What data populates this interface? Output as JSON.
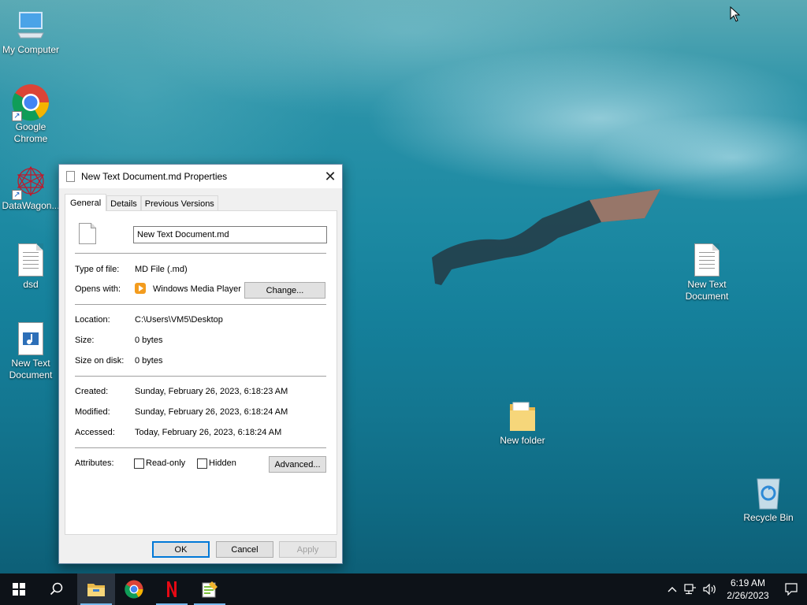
{
  "desktop": {
    "icons": [
      {
        "id": "my-computer",
        "label": "My Computer"
      },
      {
        "id": "google-chrome",
        "label": "Google Chrome"
      },
      {
        "id": "datawagon",
        "label": "DataWagon..."
      },
      {
        "id": "dsd",
        "label": "dsd"
      },
      {
        "id": "new-text-doc-left",
        "label": "New Text Document"
      },
      {
        "id": "new-text-doc-right",
        "label": "New Text Document"
      },
      {
        "id": "new-folder",
        "label": "New folder"
      },
      {
        "id": "recycle-bin",
        "label": "Recycle Bin"
      }
    ]
  },
  "dialog": {
    "title": "New Text Document.md Properties",
    "tabs": [
      {
        "label": "General",
        "active": true
      },
      {
        "label": "Details",
        "active": false
      },
      {
        "label": "Previous Versions",
        "active": false
      }
    ],
    "file_name": "New Text Document.md",
    "type_label": "Type of file:",
    "type_value": "MD File (.md)",
    "opens_label": "Opens with:",
    "opens_value": "Windows Media Player",
    "change_button": "Change...",
    "location_label": "Location:",
    "location_value": "C:\\Users\\VM5\\Desktop",
    "size_label": "Size:",
    "size_value": "0 bytes",
    "size_on_disk_label": "Size on disk:",
    "size_on_disk_value": "0 bytes",
    "created_label": "Created:",
    "created_value": "Sunday, February 26, 2023, 6:18:23 AM",
    "modified_label": "Modified:",
    "modified_value": "Sunday, February 26, 2023, 6:18:24 AM",
    "accessed_label": "Accessed:",
    "accessed_value": "Today, February 26, 2023, 6:18:24 AM",
    "attributes_label": "Attributes:",
    "readonly_label": "Read-only",
    "readonly_checked": false,
    "hidden_label": "Hidden",
    "hidden_checked": false,
    "advanced_button": "Advanced...",
    "ok_button": "OK",
    "cancel_button": "Cancel",
    "apply_button": "Apply"
  },
  "taskbar": {
    "apps": [
      "start",
      "search",
      "file-explorer",
      "google-chrome",
      "netflix",
      "notepad-plus"
    ],
    "time": "6:19 AM",
    "date": "2/26/2023"
  },
  "colors": {
    "accent": "#0078d7",
    "taskbar": "#0d1218",
    "wallpaper_water": "#1d8aa3"
  }
}
